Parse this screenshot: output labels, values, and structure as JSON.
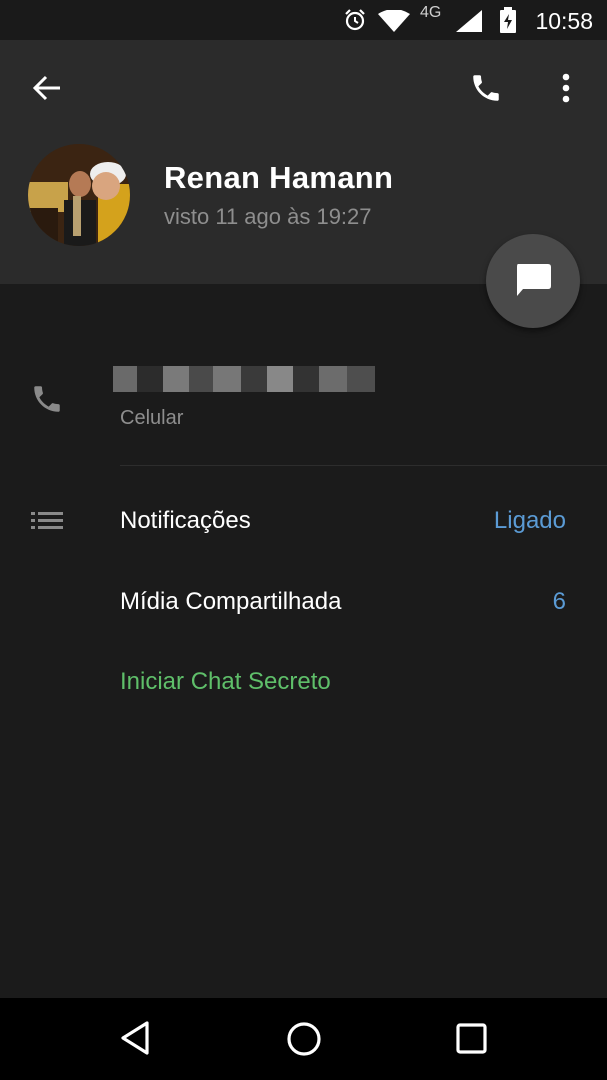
{
  "status_bar": {
    "time": "10:58",
    "network": "4G",
    "icons": [
      "alarm-icon",
      "wifi-icon",
      "signal-icon",
      "battery-charging-icon"
    ]
  },
  "header": {
    "back_icon": "arrow-left-icon",
    "call_icon": "phone-icon",
    "menu_icon": "more-vert-icon",
    "name": "Renan Hamann",
    "last_seen": "visto 11 ago às 19:27",
    "fab_icon": "message-icon"
  },
  "phone": {
    "label": "Celular",
    "icon": "phone-icon"
  },
  "notifications": {
    "label": "Notificações",
    "value": "Ligado",
    "icon": "list-icon"
  },
  "shared_media": {
    "label": "Mídia Compartilhada",
    "count": "6"
  },
  "secret_chat": {
    "label": "Iniciar Chat Secreto"
  },
  "nav": [
    "back-nav-icon",
    "home-nav-icon",
    "recents-nav-icon"
  ],
  "colors": {
    "background": "#1b1b1b",
    "header": "#2b2b2b",
    "value_blue": "#5b9bd5",
    "secret_green": "#5fbf6a",
    "muted": "#8e8e8e"
  }
}
